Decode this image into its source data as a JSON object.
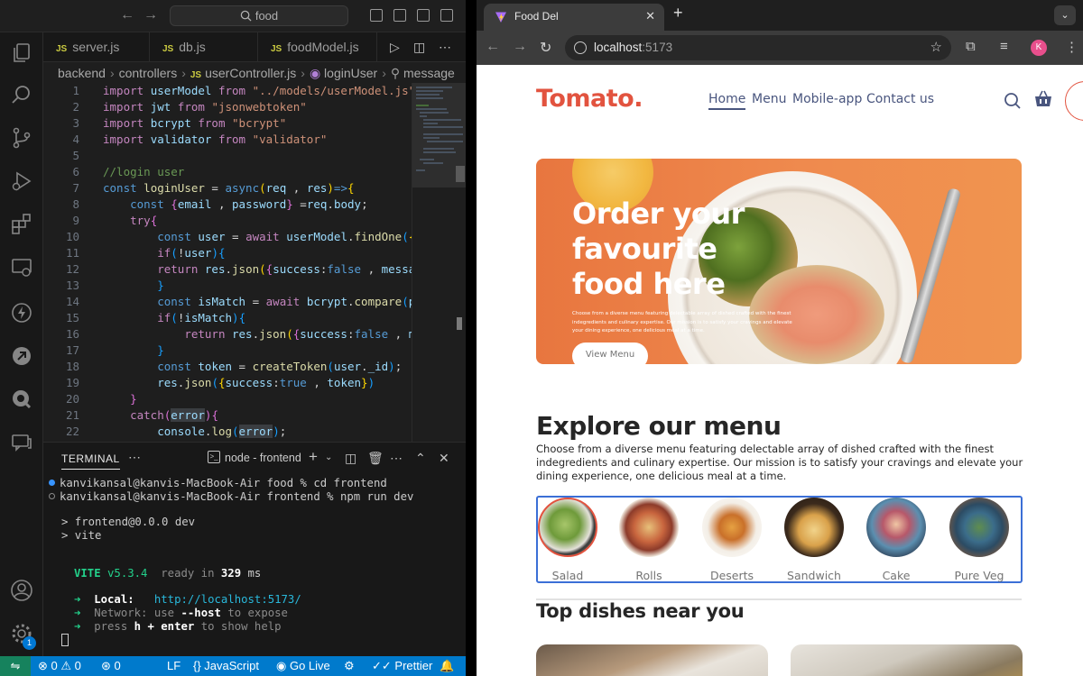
{
  "vscode": {
    "search": "food",
    "tabs": [
      "server.js",
      "db.js",
      "foodModel.js"
    ],
    "tab_icon": "JS",
    "breadcrumb": [
      "backend",
      "controllers",
      "userController.js",
      "loginUser",
      "message"
    ],
    "line_numbers": [
      "1",
      "2",
      "3",
      "4",
      "5",
      "6",
      "7",
      "8",
      "9",
      "10",
      "11",
      "12",
      "13",
      "14",
      "15",
      "16",
      "17",
      "18",
      "19",
      "20",
      "21",
      "22"
    ],
    "panel": {
      "tab": "TERMINAL",
      "terminal_name": "node - frontend",
      "lines": {
        "l1": "kanvikansal@kanvis-MacBook-Air food % cd frontend",
        "l2": "kanvikansal@kanvis-MacBook-Air frontend % npm run dev",
        "l3": "> frontend@0.0.0 dev",
        "l4": "> vite",
        "vite": "VITE",
        "vite_version": "v5.3.4",
        "ready": "ready in",
        "ready_ms": "329",
        "ms": "ms",
        "local_label": "Local:",
        "local_url": "http://localhost:5173/",
        "network_label": "Network:",
        "network_text_1": "use",
        "network_flag": "--host",
        "network_text_2": "to expose",
        "help_1": "press",
        "help_key": "h + enter",
        "help_2": "to show help"
      }
    },
    "status": {
      "errors": "0",
      "warnings": "0",
      "ports": "0",
      "eol": "LF",
      "language": "JavaScript",
      "golive": "Go Live",
      "prettier": "Prettier",
      "badge": "1"
    }
  },
  "browser": {
    "tab_title": "Food Del",
    "url_host": "localhost",
    "url_port": ":5173",
    "profile_initial": "K"
  },
  "site": {
    "logo": "Tomato.",
    "nav": [
      "Home",
      "Menu",
      "Mobile-app",
      "Contact us"
    ],
    "hero_title": "Order your favourite food here",
    "hero_desc": "Choose from a diverse menu featuring delectable array of dished crafted with the finest indegredients and culinary expertise. Our mission is to satisfy your cravings and elevate your dining experience, one delicious meal at a time.",
    "hero_button": "View Menu",
    "explore_title": "Explore our menu",
    "explore_desc": "Choose from a diverse menu featuring delectable array of dished crafted with the finest indegredients and culinary expertise. Our mission is to satisfy your cravings and elevate your dining experience, one delicious meal at a time.",
    "menu_items": [
      "Salad",
      "Rolls",
      "Deserts",
      "Sandwich",
      "Cake",
      "Pure Veg"
    ],
    "top_title": "Top dishes near you"
  },
  "colors": {
    "brand": "#e2533f",
    "nav_text": "#49557e",
    "vscode_status": "#007acc",
    "selection_border": "#3b6fd6"
  }
}
